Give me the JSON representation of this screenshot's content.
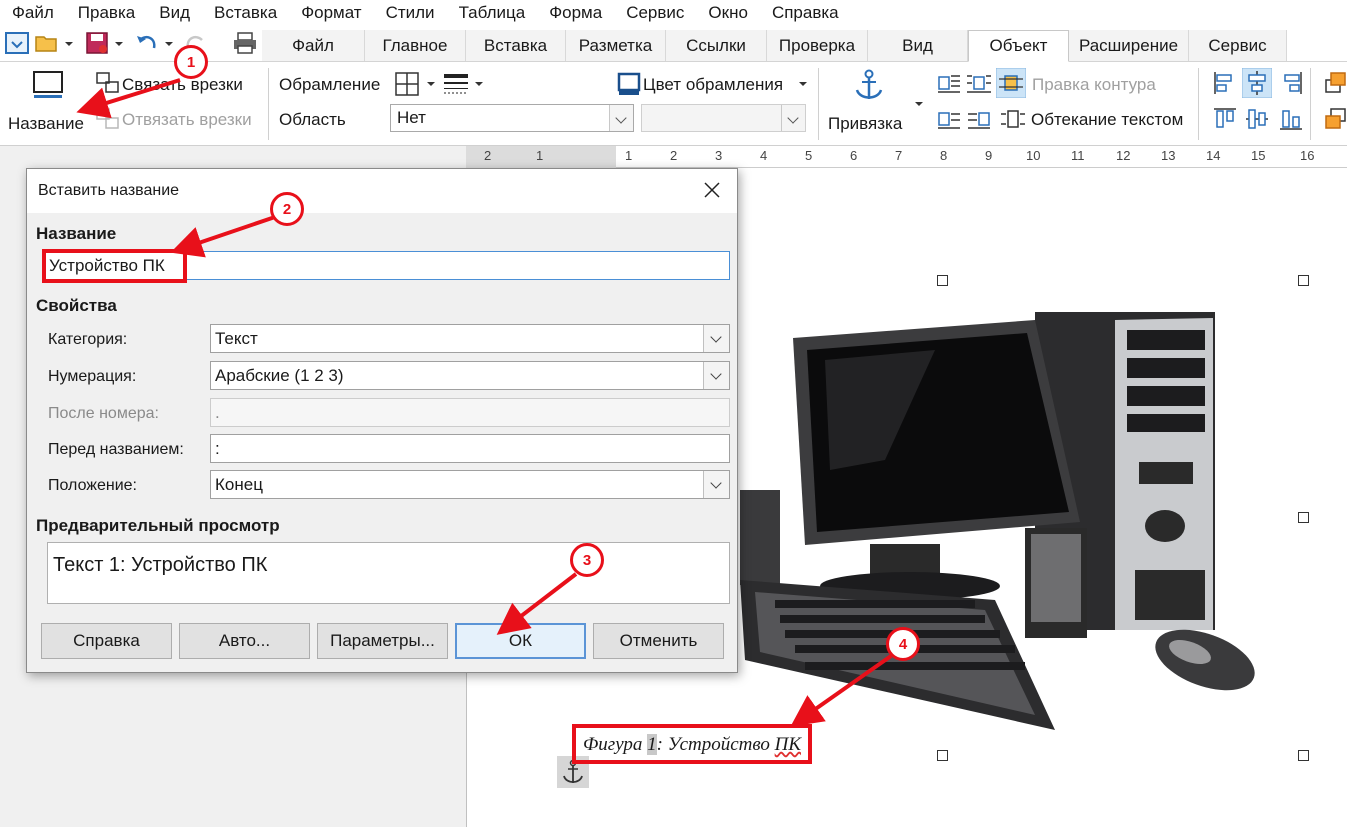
{
  "menubar": [
    "Файл",
    "Правка",
    "Вид",
    "Вставка",
    "Формат",
    "Стили",
    "Таблица",
    "Форма",
    "Сервис",
    "Окно",
    "Справка"
  ],
  "tabs": [
    "Файл",
    "Главное",
    "Вставка",
    "Разметка",
    "Ссылки",
    "Проверка",
    "Вид",
    "Объект",
    "Расширение",
    "Сервис"
  ],
  "ribbon": {
    "caption_label": "Название",
    "link_frames": "Связать врезки",
    "unlink_frames": "Отвязать врезки",
    "border_label": "Обрамление",
    "area_label": "Область",
    "area_value": "Нет",
    "border_color": "Цвет обрамления",
    "anchor_label": "Привязка",
    "edit_contour": "Правка контура",
    "text_wrap": "Обтекание текстом"
  },
  "ruler": {
    "numbers": [
      "2",
      "1",
      "1",
      "2",
      "3",
      "4",
      "5",
      "6",
      "7",
      "8",
      "9",
      "10",
      "11",
      "12",
      "13",
      "14",
      "15",
      "16"
    ]
  },
  "dialog": {
    "title": "Вставить название",
    "section_caption": "Название",
    "caption_value": "Устройство ПК",
    "section_properties": "Свойства",
    "category_label": "Категория:",
    "category_value": "Текст",
    "numbering_label": "Нумерация:",
    "numbering_value": "Арабские (1 2 3)",
    "after_number_label": "После номера:",
    "after_number_value": ".",
    "before_caption_label": "Перед названием:",
    "before_caption_value": ":",
    "position_label": "Положение:",
    "position_value": "Конец",
    "section_preview": "Предварительный просмотр",
    "preview_text": "Текст 1: Устройство ПК",
    "buttons": {
      "help": "Справка",
      "auto": "Авто...",
      "options": "Параметры...",
      "ok": "ОК",
      "cancel": "Отменить"
    }
  },
  "document": {
    "caption_prefix": "Фигура ",
    "caption_number": "1",
    "caption_sep": ": Устройство ",
    "caption_err": "ПК"
  },
  "annotations": {
    "steps": [
      "1",
      "2",
      "3",
      "4"
    ],
    "color": "#e8101a"
  },
  "colors": {
    "accent": "#4a8fd6",
    "annotation": "#e8101a"
  }
}
